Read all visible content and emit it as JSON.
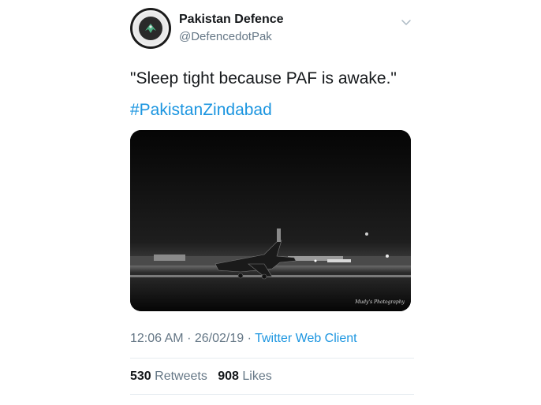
{
  "tweet": {
    "author_name": "Pakistan Defence",
    "author_handle": "@DefencedotPak",
    "text": "\"Sleep tight because PAF is awake.\"",
    "hashtag": "#PakistanZindabad",
    "image_credit": "Mudy's Photography",
    "time": "12:06 AM",
    "separator": "·",
    "date": "26/02/19",
    "client": "Twitter Web Client",
    "retweets_count": "530",
    "retweets_label": "Retweets",
    "likes_count": "908",
    "likes_label": "Likes"
  },
  "icons": {
    "avatar": "pakistan-defence-logo",
    "menu": "chevron-down-icon"
  },
  "colors": {
    "link": "#1b95e0",
    "secondary_text": "#657786",
    "primary_text": "#14171a"
  }
}
